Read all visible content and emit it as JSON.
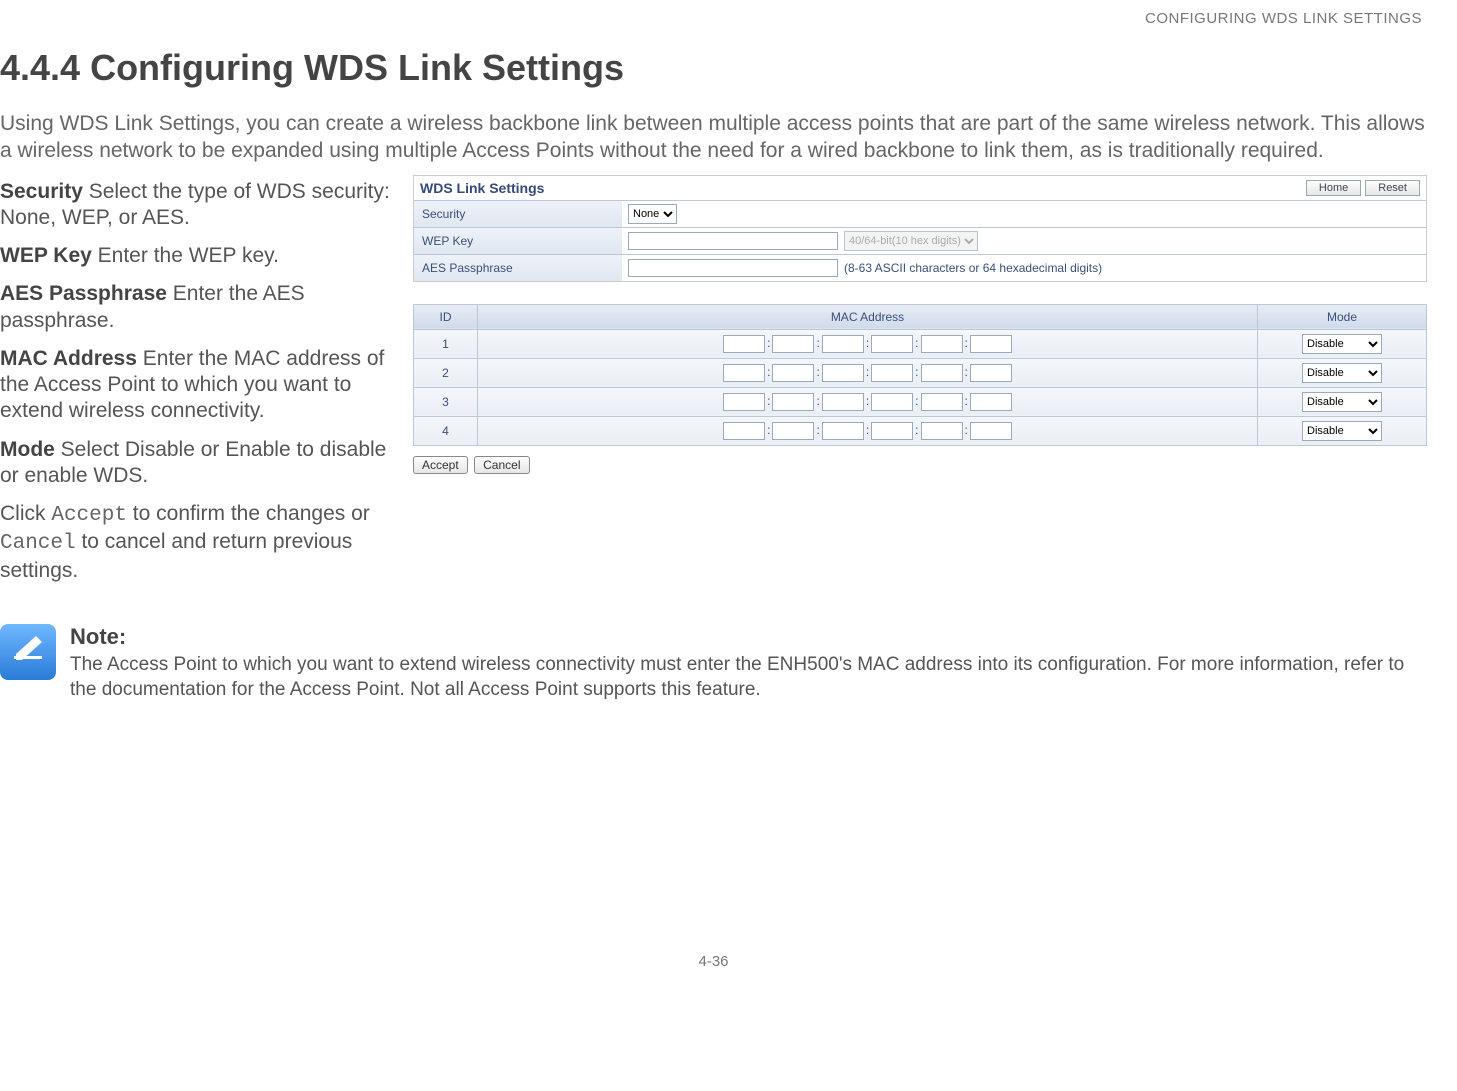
{
  "header": {
    "running_title": "CONFIGURING WDS LINK SETTINGS"
  },
  "title": "4.4.4 Configuring WDS Link Settings",
  "intro": "Using WDS Link Settings, you can create a wireless backbone link between multiple access points that are part of the same wireless network. This allows a wireless network to be expanded using multiple Access Points without the need for a wired backbone to link them, as is traditionally required.",
  "defs": {
    "security": {
      "term": "Security",
      "desc": "  Select the type of WDS security: None, WEP, or AES."
    },
    "wepkey": {
      "term": "WEP Key",
      "desc": "  Enter the WEP key."
    },
    "aes": {
      "term": "AES Passphrase",
      "desc": "  Enter the AES passphrase."
    },
    "mac": {
      "term": "MAC Address",
      "desc": "  Enter the MAC address of the Access Point to which you want to extend wireless connectivity."
    },
    "mode": {
      "term": "Mode",
      "desc": "  Select Disable or Enable to disable or enable WDS."
    }
  },
  "click_line": {
    "pre": "Click ",
    "accept": "Accept",
    "mid": " to confirm the changes or ",
    "cancel": "Cancel",
    "post": " to cancel and return previous settings."
  },
  "shot": {
    "panel_title": "WDS Link Settings",
    "btn_home": "Home",
    "btn_reset": "Reset",
    "row_security": "Security",
    "security_value": "None",
    "row_wep": "WEP Key",
    "wep_digits_option": "40/64-bit(10 hex digits)",
    "row_aes": "AES Passphrase",
    "aes_helper": "(8-63 ASCII characters or 64 hexadecimal digits)",
    "th_id": "ID",
    "th_mac": "MAC Address",
    "th_mode": "Mode",
    "rows": [
      {
        "id": "1",
        "mode": "Disable"
      },
      {
        "id": "2",
        "mode": "Disable"
      },
      {
        "id": "3",
        "mode": "Disable"
      },
      {
        "id": "4",
        "mode": "Disable"
      }
    ],
    "btn_accept": "Accept",
    "btn_cancel": "Cancel"
  },
  "note": {
    "title": "Note:",
    "body": "The Access Point to which you want to extend wireless connectivity must enter the ENH500's MAC address into its configuration. For more information, refer to the documentation for the Access Point. Not all Access Point supports this feature."
  },
  "footer": {
    "page": "4-36"
  }
}
